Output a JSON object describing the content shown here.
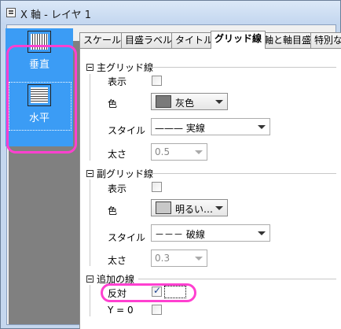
{
  "window": {
    "title": "X 軸 - レイヤ 1"
  },
  "left_panel": {
    "items": [
      {
        "label": "垂直",
        "icon": "vertical-grid-icon"
      },
      {
        "label": "水平",
        "icon": "horizontal-grid-icon"
      }
    ]
  },
  "tabs": [
    {
      "label": "スケール"
    },
    {
      "label": "目盛ラベル"
    },
    {
      "label": "タイトル"
    },
    {
      "label": "グリッド線"
    },
    {
      "label": "軸と軸目盛"
    },
    {
      "label": "特別な"
    }
  ],
  "major_grid": {
    "header": "主グリッド線",
    "show_label": "表示",
    "color_label": "色",
    "color_value": "灰色",
    "color_hex": "#7a7a7a",
    "style_label": "スタイル",
    "style_value": "——— 実線",
    "width_label": "太さ",
    "width_value": "0.5"
  },
  "minor_grid": {
    "header": "副グリッド線",
    "show_label": "表示",
    "color_label": "色",
    "color_value": "明るい…",
    "color_hex": "#c8c8c8",
    "style_label": "スタイル",
    "style_value": "－－－ 破線",
    "width_label": "太さ",
    "width_value": "0.3"
  },
  "additional": {
    "header": "追加の線",
    "opposite_label": "反対",
    "y0_label": "Y = 0"
  },
  "colors": {
    "highlight": "#ff40d0",
    "panel_accent": "#3b9cf5"
  }
}
